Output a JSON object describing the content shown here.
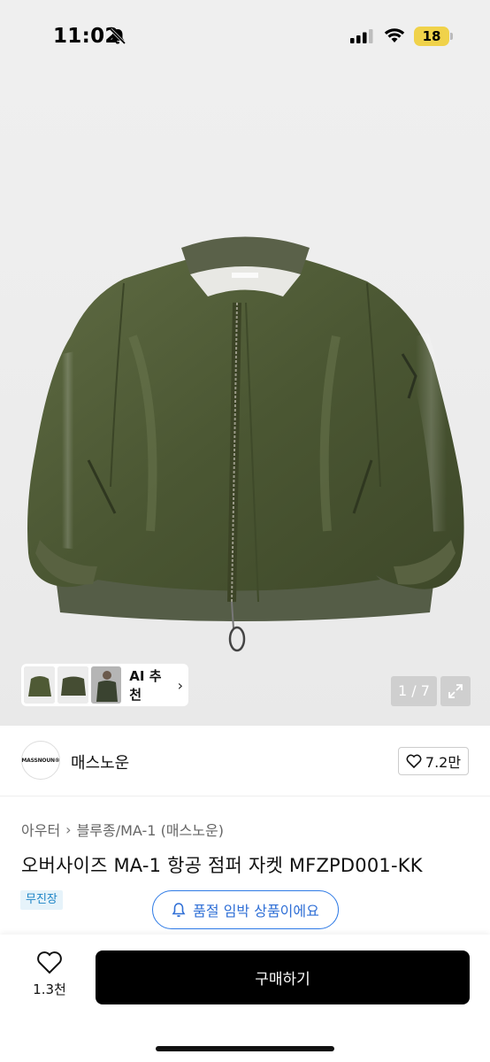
{
  "status_bar": {
    "time": "11:02",
    "battery": "18",
    "icons": [
      "bell-slash-icon",
      "signal-icon",
      "wifi-icon",
      "battery-icon"
    ]
  },
  "gallery": {
    "ai_label": "AI 추천",
    "counter": "1 / 7",
    "thumbnails": [
      "jacket-front",
      "jacket-back",
      "model-wearing"
    ],
    "current_index": 1,
    "total": 7
  },
  "brand": {
    "logo_text": "MASSNOUN®",
    "name": "매스노운",
    "likes": "7.2만"
  },
  "product": {
    "breadcrumb": [
      "아우터",
      "블루종/MA-1 (매스노운)"
    ],
    "title": "오버사이즈 MA-1 항공 점퍼 자켓 MFZPD001-KK",
    "badge": "무진장",
    "stock_notice": "품절 임박 상품이에요"
  },
  "bottom_bar": {
    "wish_count": "1.3천",
    "buy_label": "구매하기"
  },
  "colors": {
    "jacket": "#4e5a36",
    "accent_blue": "#2f7be6",
    "badge_blue": "#1c84c6",
    "battery": "#f0d24a"
  }
}
